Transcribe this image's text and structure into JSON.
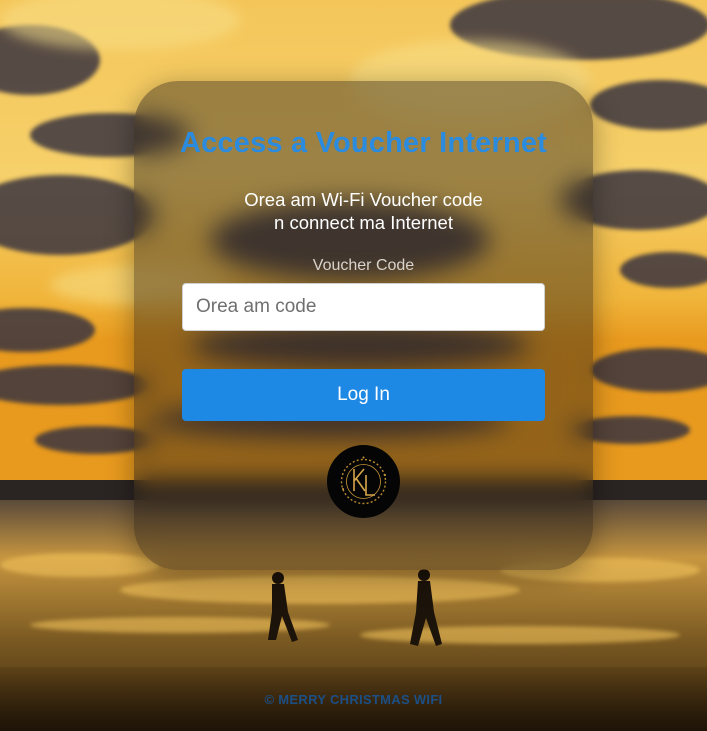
{
  "colors": {
    "title": "#2a8bdf",
    "button": "#1e88e5",
    "footer_text": "#1c4f86"
  },
  "card": {
    "title": "Access a Voucher Internet",
    "subtitle_line1": "Orea am Wi-Fi Voucher code",
    "subtitle_line2": "n connect ma Internet",
    "field_label": "Voucher Code",
    "input_placeholder": "Orea am code",
    "input_value": "",
    "login_label": "Log In"
  },
  "logo": {
    "monogram": "KL",
    "icon": "kl-monogram-logo"
  },
  "footer": {
    "text": "© MERRY CHRISTMAS WIFI"
  }
}
